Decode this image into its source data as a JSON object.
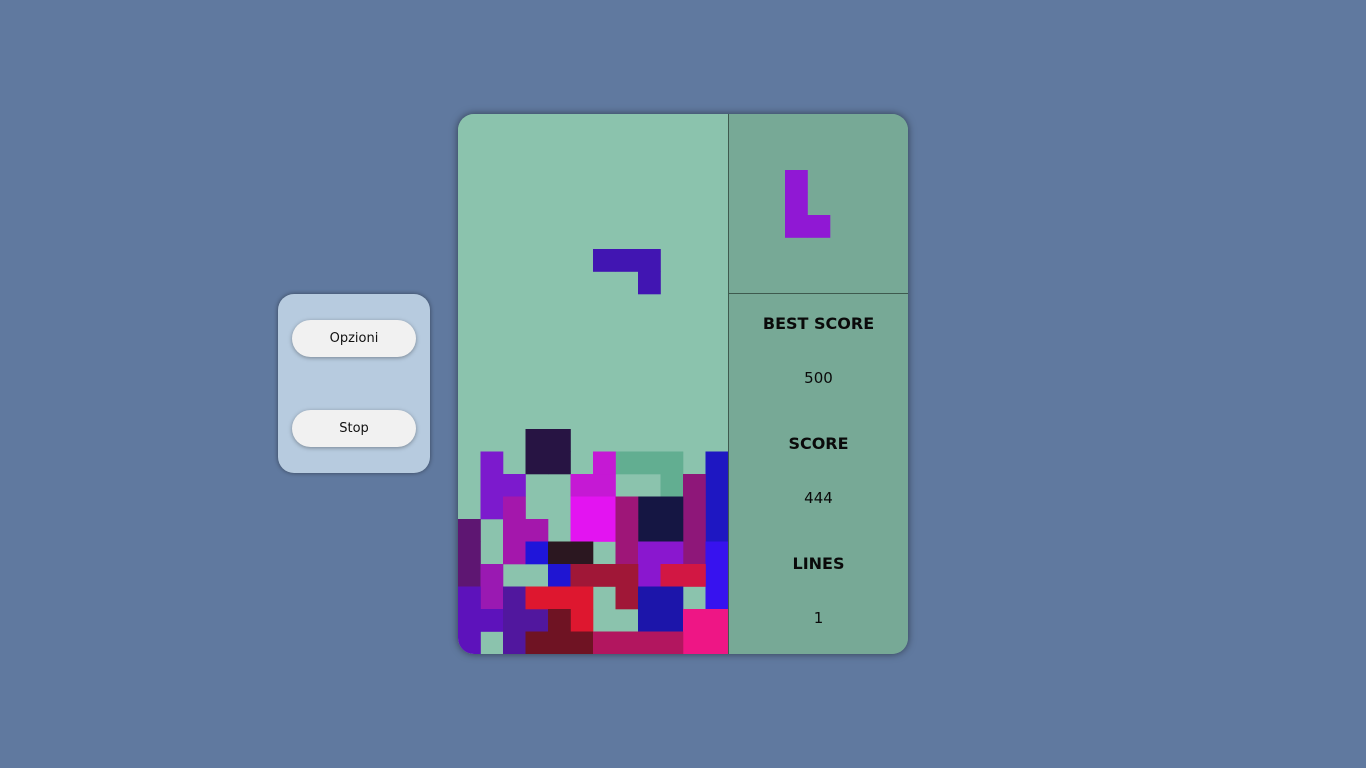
{
  "controls": {
    "options_label": "Opzioni",
    "stop_label": "Stop"
  },
  "stats": {
    "best_score_label": "BEST SCORE",
    "best_score_value": "500",
    "score_label": "SCORE",
    "score_value": "444",
    "lines_label": "LINES",
    "lines_value": "1"
  },
  "board": {
    "cols": 12,
    "rows": 24,
    "background": "#8bc3ad",
    "ghost_color": "#62ae91",
    "active_piece": {
      "color": "#4115b2",
      "cells": [
        [
          6,
          6
        ],
        [
          7,
          6
        ],
        [
          8,
          6
        ],
        [
          8,
          7
        ]
      ]
    },
    "ghost_piece": {
      "cells": [
        [
          7,
          15
        ],
        [
          8,
          15
        ],
        [
          9,
          15
        ],
        [
          9,
          16
        ]
      ]
    },
    "locked_cells": [
      [
        [
          3,
          14
        ],
        "#271443"
      ],
      [
        [
          4,
          14
        ],
        "#271443"
      ],
      [
        [
          3,
          15
        ],
        "#271443"
      ],
      [
        [
          4,
          15
        ],
        "#271443"
      ],
      [
        [
          1,
          15
        ],
        "#7c1acd"
      ],
      [
        [
          1,
          16
        ],
        "#7c1acd"
      ],
      [
        [
          2,
          16
        ],
        "#7c1acd"
      ],
      [
        [
          1,
          17
        ],
        "#7c1acd"
      ],
      [
        [
          5,
          16
        ],
        "#c519d4"
      ],
      [
        [
          6,
          16
        ],
        "#c519d4"
      ],
      [
        [
          5,
          17
        ],
        "#c519d4"
      ],
      [
        [
          6,
          15
        ],
        "#c519d4"
      ],
      [
        [
          11,
          15
        ],
        "#1e17c2"
      ],
      [
        [
          11,
          16
        ],
        "#1e17c2"
      ],
      [
        [
          11,
          17
        ],
        "#1e17c2"
      ],
      [
        [
          11,
          18
        ],
        "#1e17c2"
      ],
      [
        [
          10,
          16
        ],
        "#8e1779"
      ],
      [
        [
          10,
          17
        ],
        "#8e1779"
      ],
      [
        [
          10,
          18
        ],
        "#8e1779"
      ],
      [
        [
          10,
          19
        ],
        "#8e1779"
      ],
      [
        [
          8,
          17
        ],
        "#151643"
      ],
      [
        [
          9,
          17
        ],
        "#151643"
      ],
      [
        [
          8,
          18
        ],
        "#151643"
      ],
      [
        [
          9,
          18
        ],
        "#151643"
      ],
      [
        [
          5,
          17
        ],
        "#e314f1"
      ],
      [
        [
          6,
          17
        ],
        "#e314f1"
      ],
      [
        [
          5,
          18
        ],
        "#e314f1"
      ],
      [
        [
          6,
          18
        ],
        "#e314f1"
      ],
      [
        [
          7,
          17
        ],
        "#9e1678"
      ],
      [
        [
          7,
          18
        ],
        "#9e1678"
      ],
      [
        [
          7,
          19
        ],
        "#9e1678"
      ],
      [
        [
          2,
          17
        ],
        "#a417ac"
      ],
      [
        [
          2,
          18
        ],
        "#a417ac"
      ],
      [
        [
          3,
          18
        ],
        "#a417ac"
      ],
      [
        [
          2,
          19
        ],
        "#a417ac"
      ],
      [
        [
          0,
          18
        ],
        "#5e1672"
      ],
      [
        [
          0,
          19
        ],
        "#5e1672"
      ],
      [
        [
          0,
          20
        ],
        "#5e1672"
      ],
      [
        [
          3,
          19
        ],
        "#1f15da"
      ],
      [
        [
          4,
          19
        ],
        "#2b1720"
      ],
      [
        [
          5,
          19
        ],
        "#2b1720"
      ],
      [
        [
          8,
          19
        ],
        "#8a17cf"
      ],
      [
        [
          9,
          19
        ],
        "#8a17cf"
      ],
      [
        [
          8,
          20
        ],
        "#8a17cf"
      ],
      [
        [
          11,
          19
        ],
        "#3712ef"
      ],
      [
        [
          11,
          20
        ],
        "#3712ef"
      ],
      [
        [
          11,
          21
        ],
        "#3712ef"
      ],
      [
        [
          1,
          20
        ],
        "#9a19b2"
      ],
      [
        [
          1,
          21
        ],
        "#9a19b2"
      ],
      [
        [
          4,
          20
        ],
        "#1f15d2"
      ],
      [
        [
          5,
          20
        ],
        "#a01737"
      ],
      [
        [
          6,
          20
        ],
        "#a01737"
      ],
      [
        [
          7,
          20
        ],
        "#a01737"
      ],
      [
        [
          7,
          21
        ],
        "#a01737"
      ],
      [
        [
          9,
          20
        ],
        "#d21743"
      ],
      [
        [
          10,
          20
        ],
        "#d21743"
      ],
      [
        [
          0,
          21
        ],
        "#5d12bb"
      ],
      [
        [
          0,
          22
        ],
        "#5d12bb"
      ],
      [
        [
          1,
          22
        ],
        "#5d12bb"
      ],
      [
        [
          0,
          23
        ],
        "#5d12bb"
      ],
      [
        [
          2,
          21
        ],
        "#51179e"
      ],
      [
        [
          2,
          22
        ],
        "#51179e"
      ],
      [
        [
          3,
          22
        ],
        "#51179e"
      ],
      [
        [
          2,
          23
        ],
        "#51179e"
      ],
      [
        [
          3,
          21
        ],
        "#de172f"
      ],
      [
        [
          4,
          21
        ],
        "#de172f"
      ],
      [
        [
          5,
          21
        ],
        "#de172f"
      ],
      [
        [
          5,
          22
        ],
        "#de172f"
      ],
      [
        [
          8,
          21
        ],
        "#1c15aa"
      ],
      [
        [
          9,
          21
        ],
        "#1c15aa"
      ],
      [
        [
          8,
          22
        ],
        "#1c15aa"
      ],
      [
        [
          9,
          22
        ],
        "#1c15aa"
      ],
      [
        [
          4,
          22
        ],
        "#6f1323"
      ],
      [
        [
          3,
          23
        ],
        "#6f1323"
      ],
      [
        [
          4,
          23
        ],
        "#6f1323"
      ],
      [
        [
          5,
          23
        ],
        "#6f1323"
      ],
      [
        [
          10,
          22
        ],
        "#ee1685"
      ],
      [
        [
          11,
          22
        ],
        "#ee1685"
      ],
      [
        [
          10,
          23
        ],
        "#ee1685"
      ],
      [
        [
          11,
          23
        ],
        "#ee1685"
      ],
      [
        [
          6,
          23
        ],
        "#b2165f"
      ],
      [
        [
          7,
          23
        ],
        "#b2165f"
      ],
      [
        [
          8,
          23
        ],
        "#b2165f"
      ],
      [
        [
          9,
          23
        ],
        "#b2165f"
      ]
    ]
  },
  "next_piece": {
    "shape": "L",
    "color": "#9018d4",
    "cells": [
      [
        0,
        0
      ],
      [
        0,
        1
      ],
      [
        0,
        2
      ],
      [
        1,
        2
      ]
    ]
  }
}
